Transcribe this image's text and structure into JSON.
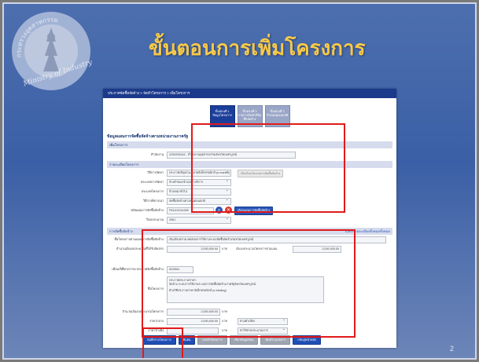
{
  "slide": {
    "title": "ขั้นตอนการเพิ่มโครงการ",
    "page_number": "2",
    "logo_ring_text": "กระทรวงอุตสาหกรรม Ministry of Industry"
  },
  "app": {
    "breadcrumb": "ประกาศจัดซื้อจัดจ้าง > จัดทำโครงการ > เพิ่มโครงการ",
    "steps": [
      {
        "line1": "ขั้นตอนที่ 1",
        "line2": "ข้อมูลโครงการ",
        "active": true
      },
      {
        "line1": "ขั้นตอนที่ 2",
        "line2": "รายการสินค้าที่จัดซื้อจัดจ้าง",
        "active": false
      },
      {
        "line1": "ขั้นตอนที่ 3",
        "line2": "กำหนดคุณสมบัติ",
        "active": false
      }
    ],
    "section_title": "ข้อมูลแผนการจัดซื้อจัดจ้างตามหน่วยงานภาครัฐ",
    "agency": {
      "header": "เพิ่มโครงการ",
      "label": "สำนักงาน",
      "value": "2200200044 - สำนักงานอุตสาหกรรมจังหวัดเพชรบูรณ์"
    },
    "project_details": {
      "header": "รายละเอียดโครงการ",
      "fields": [
        {
          "label": "วิธีการจัดหา",
          "value": "ประกาศเชิญชวน-ตลาดอิเล็กทรอนิกส์ (e-market)"
        },
        {
          "label": "ประเภทการจัดหา",
          "value": "จ้างทำของ/จ้างเหมาบริการ"
        },
        {
          "label": "ประเภทโครงการ",
          "value": "จ้างเหมาทั่วไป"
        },
        {
          "label": "วิธีการพิจารณา",
          "value": "จัดซื้อจัดจ้างตามขั้นตอนปกติ"
        },
        {
          "label": "รหัสแผนการจัดซื้อจัดจ้าง",
          "value": "P61101014289"
        },
        {
          "label": "ปีงบประมาณ",
          "value": "2561"
        }
      ],
      "policy_button": "เงื่อนไขนโยบายการจัดซื้อจัดจ้าง",
      "select_plan_button": "เลือกแผนการจัดซื้อจัดจ้าง"
    },
    "procurement": {
      "header": "การจัดซื้อจัดจ้าง",
      "header_right": "แสดงรายละเอียดทั้งหมดทั้งหมด",
      "plan_name_label": "ชื่อโครงการตามแผนการจัดซื้อจัดจ้าง",
      "plan_name_value": "เงินเฟ้อ-ตลาด-ทดสอบการใช้งานระบบจัดซื้อจัดจ้างจังหวัดเพชรบูรณ์",
      "budget_label": "จำนวนเงินงบประมาณที่ได้รับจัดสรร",
      "budget_value": "2,000,000.00",
      "unit": "บาท",
      "budget2_label": "เงินงบประมาณโครงการตามแผน",
      "budget2_value": "2,000,000.00",
      "announce_label": "เดือน/ปีที่คาดว่าจะประกาศจัดซื้อจัดจ้าง",
      "announce_value": "02/2561",
      "project_name_label": "ชื่อโครงการ",
      "project_name_lines": [
        "ประกาศประกวดราคา",
        "จัดจ้าง-ระบบการใช้งานระบบการจัดซื้อจัดจ้างภาครัฐจังหวัดเพชรบูรณ์",
        "ด้วยวิธีประกวดราคาอิเล็กทรอนิกส์ (e-bidding)"
      ],
      "approved_budget_label": "จำนวนเงินงบประมาณโครงการ",
      "approved_budget_value": "2,000,000.00",
      "median_label": "ราคากลาง",
      "median_value": "2,000,000.00",
      "median_extra": "ตามตัวเลือก",
      "reference_label": "ราคาอ้างอิง",
      "reference_value": "",
      "reference_extra": "ค่าใช้จ่ายประมาณการ"
    },
    "buttons": {
      "save": "บันทึกร่างโครงการ",
      "confirm": "ยืนยัน",
      "b3": "ยกเลิกโครงการ",
      "b4": "เรียกข้อมูลย้อน",
      "b5": "พิมพ์ร่างเอกสาร",
      "back": "กลับสู่หน้าหลัก"
    }
  },
  "colors": {
    "slide_bg": "#3b5fa6",
    "title": "#f7c948",
    "highlight": "#e11a1a",
    "primary": "#1f4fb5"
  }
}
